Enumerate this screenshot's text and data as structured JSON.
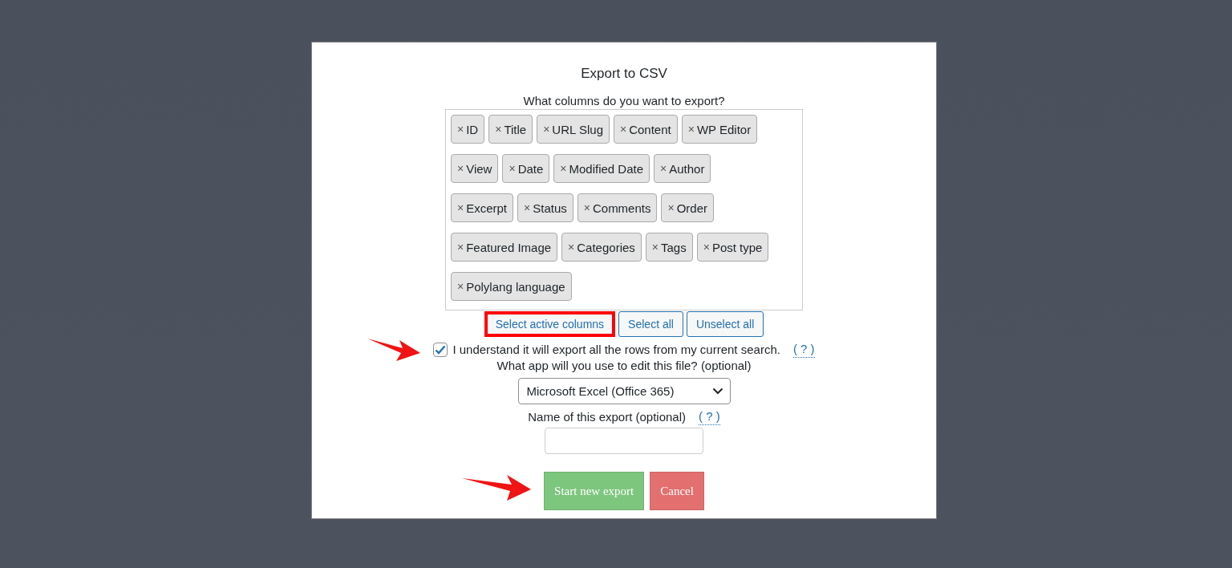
{
  "dialog": {
    "title": "Export to CSV",
    "columns_prompt": "What columns do you want to export?",
    "columns": [
      {
        "label": "ID"
      },
      {
        "label": "Title"
      },
      {
        "label": "URL Slug"
      },
      {
        "label": "Content"
      },
      {
        "label": "WP Editor"
      },
      {
        "label": "View"
      },
      {
        "label": "Date"
      },
      {
        "label": "Modified Date"
      },
      {
        "label": "Author"
      },
      {
        "label": "Excerpt"
      },
      {
        "label": "Status"
      },
      {
        "label": "Comments"
      },
      {
        "label": "Order"
      },
      {
        "label": "Featured Image"
      },
      {
        "label": "Categories"
      },
      {
        "label": "Tags"
      },
      {
        "label": "Post type"
      },
      {
        "label": "Polylang language"
      }
    ],
    "remove_glyph": "×",
    "column_buttons": [
      {
        "label": "Select active columns",
        "highlighted": true
      },
      {
        "label": "Select all",
        "highlighted": false
      },
      {
        "label": "Unselect all",
        "highlighted": false
      }
    ],
    "confirm": {
      "label": "I understand it will export all the rows from my current search.",
      "checked": true,
      "help": "( ? )"
    },
    "app_prompt": "What app will you use to edit this file? (optional)",
    "app_select": {
      "value": "Microsoft Excel (Office 365)"
    },
    "name_prompt": "Name of this export (optional)",
    "name_help": "( ? )",
    "actions": [
      {
        "label": "Start new export",
        "kind": "primary"
      },
      {
        "label": "Cancel",
        "kind": "cancel"
      }
    ]
  }
}
